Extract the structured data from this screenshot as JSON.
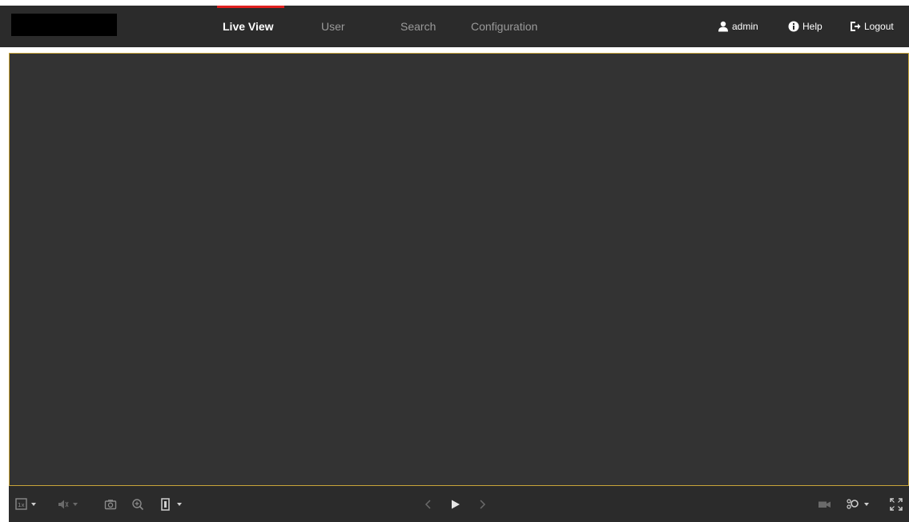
{
  "header": {
    "nav": [
      {
        "label": "Live View",
        "active": true
      },
      {
        "label": "User",
        "active": false
      },
      {
        "label": "Search",
        "active": false
      },
      {
        "label": "Configuration",
        "active": false
      }
    ],
    "user_label": "admin",
    "help_label": "Help",
    "logout_label": "Logout"
  },
  "colors": {
    "header_bg": "#2b2b2b",
    "viewer_bg": "#333333",
    "active_indicator": "#e0201f",
    "viewer_border": "#c8a53a"
  },
  "toolbar": {
    "icons": [
      "window-layout-icon",
      "volume-icon",
      "capture-icon",
      "zoom-icon",
      "stream-icon",
      "prev-icon",
      "play-icon",
      "next-icon",
      "record-icon",
      "ptz-icon",
      "fullscreen-icon"
    ]
  }
}
